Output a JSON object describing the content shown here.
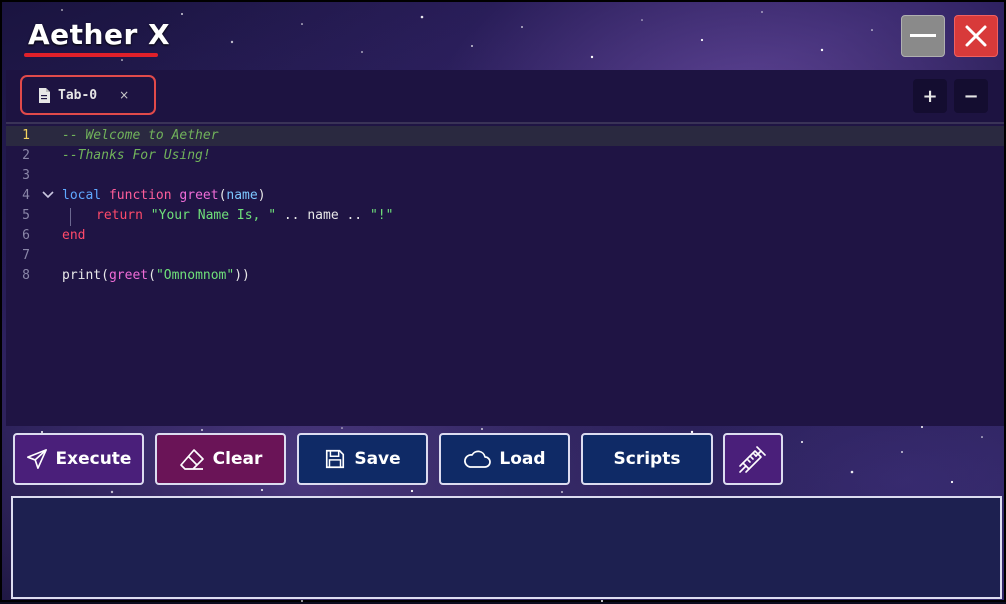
{
  "app": {
    "title": "Aether X"
  },
  "window_controls": {
    "minimize_icon": "minimize-icon",
    "close_icon": "close-icon"
  },
  "tabs": [
    {
      "label": "Tab-0",
      "close": "×"
    }
  ],
  "tab_controls": {
    "add": "+",
    "remove": "−"
  },
  "editor": {
    "line_numbers": [
      "1",
      "2",
      "3",
      "4",
      "5",
      "6",
      "7",
      "8"
    ],
    "active_line": 1,
    "lines": [
      {
        "comment": "-- Welcome to Aether"
      },
      {
        "comment": "--Thanks For Using!"
      },
      {},
      {
        "kw": "local",
        "fn": "function",
        "name": "greet",
        "paren_open": "(",
        "param": "name",
        "paren_close": ")"
      },
      {
        "kw": "return",
        "str1": "\"Your Name Is, \"",
        "op1": " .. ",
        "var": "name",
        "op2": " .. ",
        "str2": "\"!\""
      },
      {
        "kw": "end"
      },
      {},
      {
        "pre": "print(",
        "name": "greet",
        "open": "(",
        "str": "\"Omnomnom\"",
        "close": "))"
      }
    ]
  },
  "buttons": {
    "execute": "Execute",
    "clear": "Clear",
    "save": "Save",
    "load": "Load",
    "scripts": "Scripts"
  },
  "colors": {
    "accent_red": "#e14a4a",
    "editor_bg": "#1f1444",
    "console_bg": "#1d2050"
  }
}
